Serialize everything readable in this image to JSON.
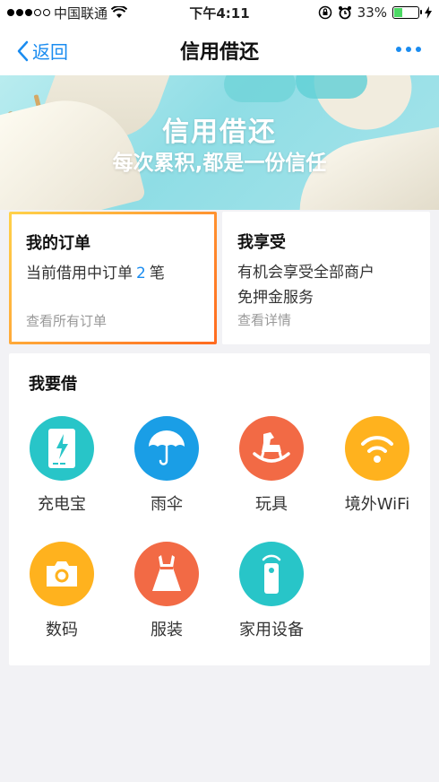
{
  "status_bar": {
    "carrier": "中国联通",
    "time": "下午4:11",
    "battery": "33%",
    "battery_level": 0.33
  },
  "nav": {
    "back_label": "返回",
    "title": "信用借还"
  },
  "banner": {
    "title": "信用借还",
    "subtitle": "每次累积,都是一份信任"
  },
  "orders_card": {
    "title": "我的订单",
    "text_before": "当前借用中订单",
    "count": "2",
    "text_after": "笔",
    "link": "查看所有订单"
  },
  "enjoy_card": {
    "title": "我享受",
    "line1": "有机会享受全部商户",
    "line2": "免押金服务",
    "link": "查看详情"
  },
  "borrow": {
    "title": "我要借",
    "items": [
      {
        "label": "充电宝",
        "icon": "power-bank-icon",
        "color": "#28c5c8"
      },
      {
        "label": "雨伞",
        "icon": "umbrella-icon",
        "color": "#1a9ee6"
      },
      {
        "label": "玩具",
        "icon": "rocking-horse-icon",
        "color": "#f26a45"
      },
      {
        "label": "境外WiFi",
        "icon": "wifi-icon",
        "color": "#ffb21e"
      },
      {
        "label": "数码",
        "icon": "camera-icon",
        "color": "#ffb21e"
      },
      {
        "label": "服装",
        "icon": "dress-icon",
        "color": "#f26a45"
      },
      {
        "label": "家用设备",
        "icon": "remote-control-icon",
        "color": "#28c5c8"
      }
    ]
  }
}
